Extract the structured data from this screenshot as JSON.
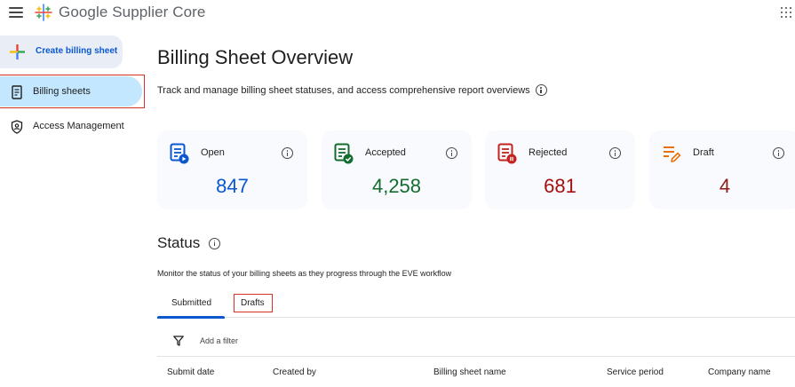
{
  "app": {
    "title": "Google Supplier Core"
  },
  "sidebar": {
    "create_label": "Create billing sheet",
    "items": [
      {
        "label": "Billing sheets",
        "icon": "receipt-icon",
        "active": true
      },
      {
        "label": "Access Management",
        "icon": "shield-person-icon",
        "active": false
      }
    ]
  },
  "main": {
    "title": "Billing Sheet Overview",
    "subtitle": "Track and manage billing sheet statuses, and access comprehensive report overviews",
    "cards": [
      {
        "label": "Open",
        "value": "847",
        "color": "#0b57d0",
        "icon": "open-sheet-icon"
      },
      {
        "label": "Accepted",
        "value": "4,258",
        "color": "#146c2e",
        "icon": "accepted-sheet-icon"
      },
      {
        "label": "Rejected",
        "value": "681",
        "color": "#a50e0e",
        "icon": "rejected-sheet-icon"
      },
      {
        "label": "Draft",
        "value": "4",
        "color": "#8c1d18",
        "icon": "draft-edit-icon"
      }
    ],
    "status": {
      "title": "Status",
      "description": "Monitor the status of your billing sheets as they progress through the EVE workflow",
      "tabs": [
        {
          "label": "Submitted",
          "selected": true
        },
        {
          "label": "Drafts",
          "selected": false
        }
      ],
      "filter_label": "Add a filter",
      "columns": [
        "Submit date",
        "Created by",
        "Billing sheet name",
        "Service period",
        "Company name"
      ]
    }
  },
  "colors": {
    "accent": "#0b57d0",
    "nav_active_bg": "#c2e7ff",
    "highlight": "#d93025"
  }
}
